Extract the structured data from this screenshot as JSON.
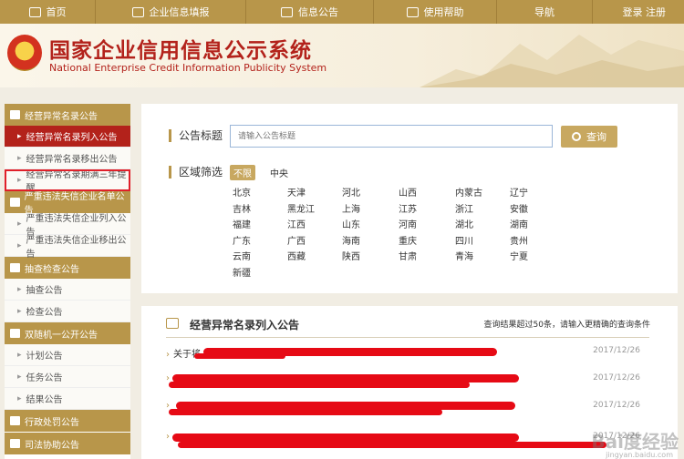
{
  "nav": {
    "home": "首页",
    "fill_info": "企业信息填报",
    "announcements": "信息公告",
    "help": "使用帮助",
    "guide": "导航",
    "login": "登录",
    "register": "注册"
  },
  "header": {
    "title_cn": "国家企业信用信息公示系统",
    "title_en": "National Enterprise Credit Information Publicity System"
  },
  "sidebar": {
    "sections": [
      {
        "label": "经营异常名录公告",
        "items": [
          "经营异常名录列入公告",
          "经营异常名录移出公告",
          "经营异常名录期满三年提醒"
        ]
      },
      {
        "label": "严重违法失信企业名单公告",
        "items": [
          "严重违法失信企业列入公告",
          "严重违法失信企业移出公告"
        ]
      },
      {
        "label": "抽查检查公告",
        "items": [
          "抽查公告",
          "检查公告"
        ]
      },
      {
        "label": "双随机一公开公告",
        "items": [
          "计划公告",
          "任务公告",
          "结果公告"
        ]
      },
      {
        "label": "行政处罚公告",
        "items": []
      },
      {
        "label": "司法协助公告",
        "items": []
      }
    ]
  },
  "search": {
    "title_label": "公告标题",
    "placeholder": "请输入公告标题",
    "button": "查询",
    "region_label": "区域筛选",
    "chip_all": "不限",
    "chip_central": "中央",
    "regions": [
      "北京",
      "天津",
      "河北",
      "山西",
      "内蒙古",
      "辽宁",
      "吉林",
      "黑龙江",
      "上海",
      "江苏",
      "浙江",
      "安徽",
      "福建",
      "江西",
      "山东",
      "河南",
      "湖北",
      "湖南",
      "广东",
      "广西",
      "海南",
      "重庆",
      "四川",
      "贵州",
      "云南",
      "西藏",
      "陕西",
      "甘肃",
      "青海",
      "宁夏",
      "新疆"
    ]
  },
  "results": {
    "title": "经营异常名录列入公告",
    "note": "查询结果超过50条，请输入更精确的查询条件",
    "rows": [
      {
        "text": "关于将",
        "date": "2017/12/26"
      },
      {
        "text": "",
        "date": "2017/12/26"
      },
      {
        "text": "",
        "date": "2017/12/26"
      },
      {
        "text": "",
        "date": "2017/12/26"
      }
    ]
  },
  "watermark": {
    "main": "Bai度经验",
    "sub": "jingyan.baidu.com"
  },
  "colors": {
    "gold": "#b8964a",
    "red": "#b3221b",
    "redact": "#e60a15"
  }
}
